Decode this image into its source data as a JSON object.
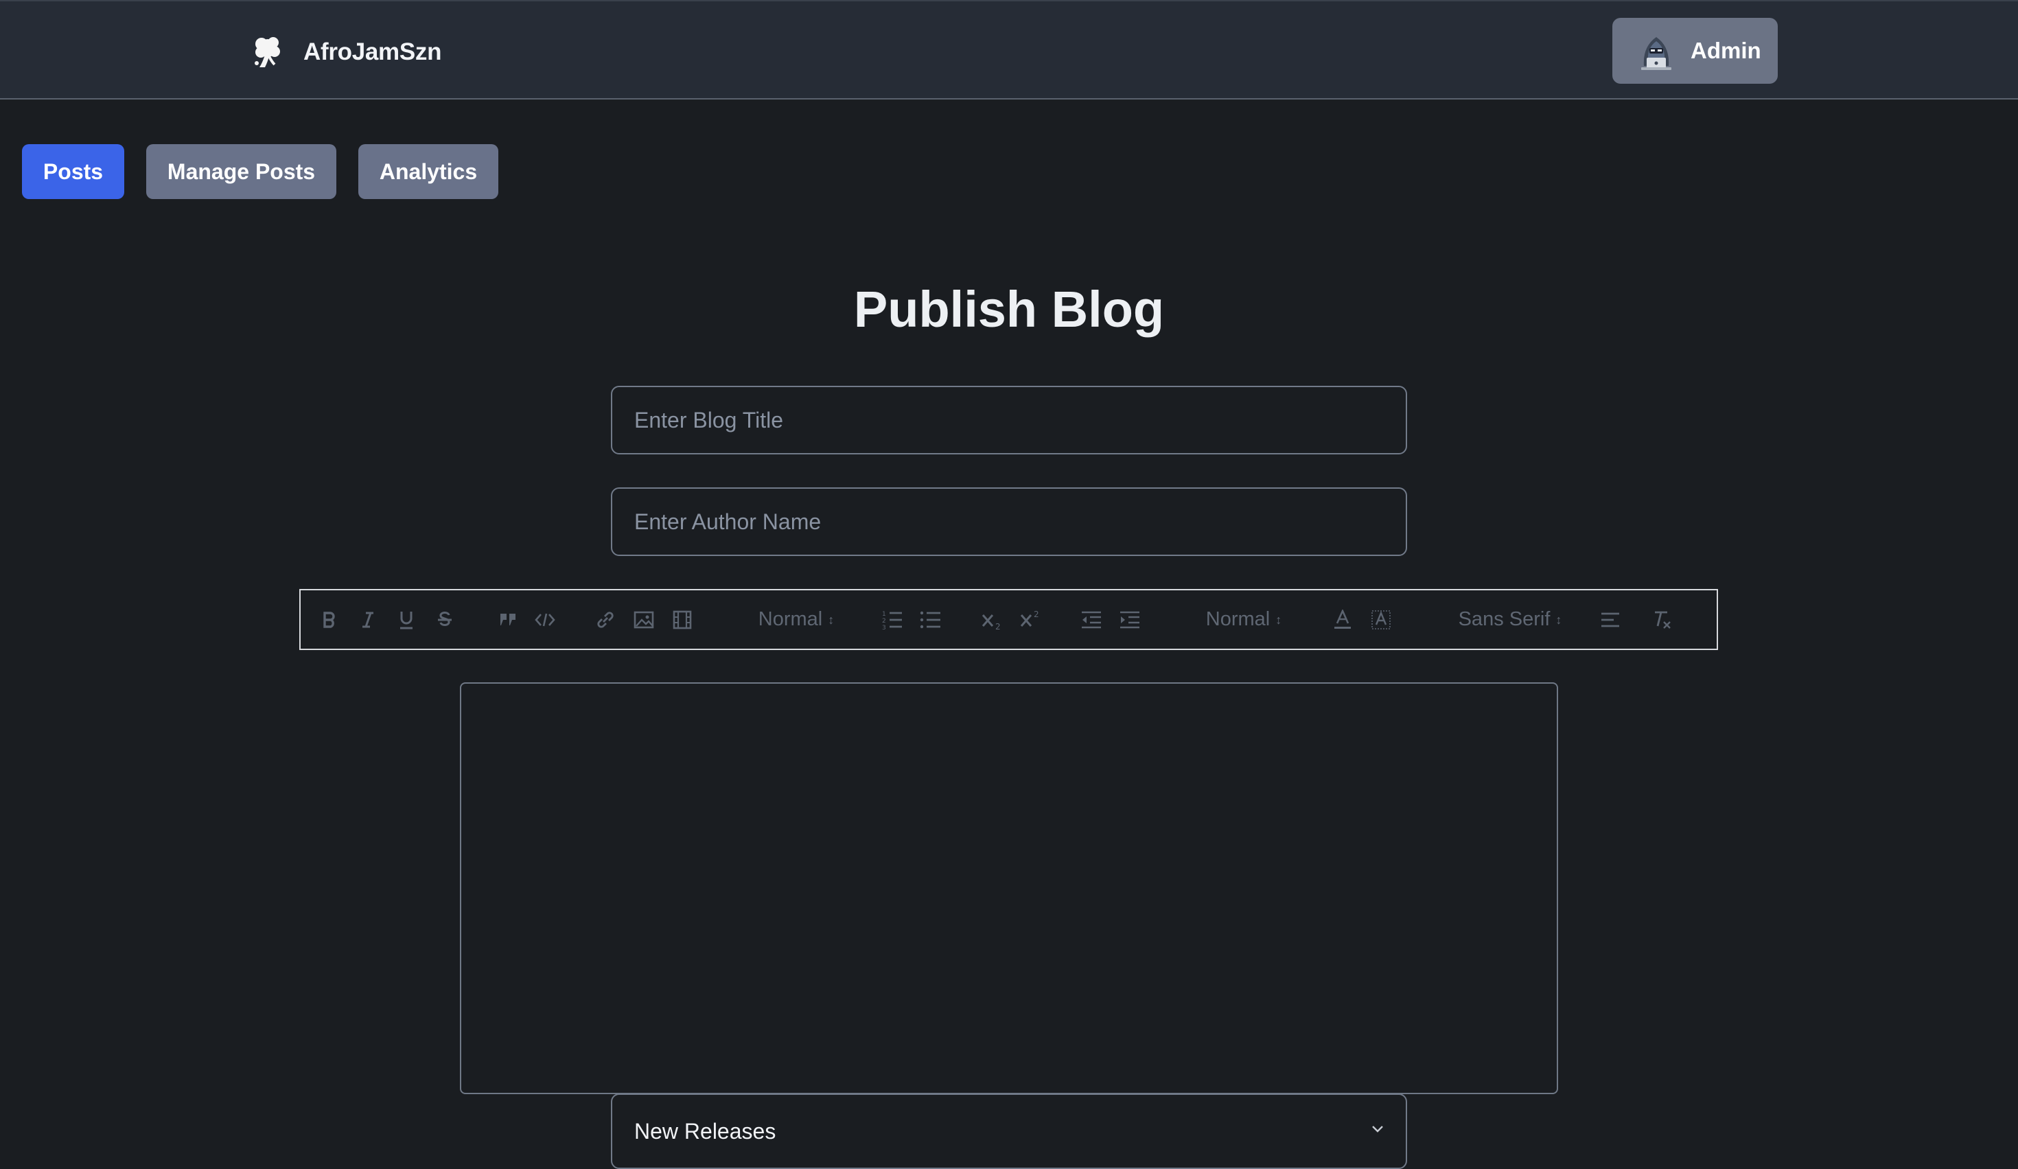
{
  "header": {
    "brand_name": "AfroJamSzn",
    "admin_label": "Admin"
  },
  "nav": {
    "posts": "Posts",
    "manage_posts": "Manage Posts",
    "analytics": "Analytics"
  },
  "main": {
    "title": "Publish Blog",
    "blog_title_placeholder": "Enter Blog Title",
    "author_placeholder": "Enter Author Name",
    "category_selected": "New Releases"
  },
  "toolbar": {
    "header_select": "Normal",
    "size_select": "Normal",
    "font_select": "Sans Serif",
    "icons": [
      "bold-icon",
      "italic-icon",
      "underline-icon",
      "strike-icon",
      "blockquote-icon",
      "code-block-icon",
      "link-icon",
      "image-icon",
      "video-icon",
      "ordered-list-icon",
      "bullet-list-icon",
      "subscript-icon",
      "superscript-icon",
      "outdent-icon",
      "indent-icon",
      "text-color-icon",
      "background-color-icon",
      "align-icon",
      "clean-format-icon"
    ]
  },
  "colors": {
    "page_bg": "#1a1d21",
    "header_bg": "#262c36",
    "primary": "#3b64e8",
    "secondary": "#69728a",
    "admin_button": "#6b7385"
  }
}
